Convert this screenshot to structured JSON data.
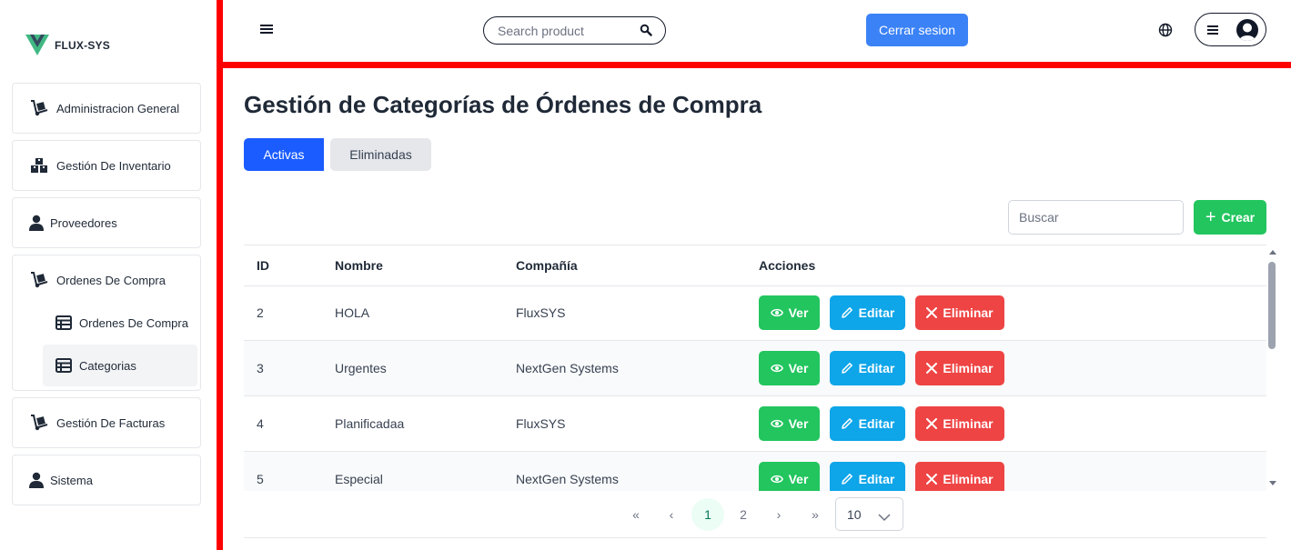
{
  "brand": {
    "name": "FLUX-SYS"
  },
  "sidebar": {
    "items": [
      {
        "label": "Administracion General"
      },
      {
        "label": "Gestión De Inventario"
      },
      {
        "label": "Proveedores"
      },
      {
        "label": "Ordenes De Compra"
      },
      {
        "label": "Gestión De Facturas"
      },
      {
        "label": "Sistema"
      }
    ],
    "subitems": [
      {
        "label": "Ordenes De Compra"
      },
      {
        "label": "Categorias"
      }
    ]
  },
  "topbar": {
    "search_placeholder": "Search product",
    "logout_label": "Cerrar sesion"
  },
  "main": {
    "title": "Gestión de Categorías de Órdenes de Compra",
    "tabs": [
      {
        "label": "Activas"
      },
      {
        "label": "Eliminadas"
      }
    ],
    "search_placeholder": "Buscar",
    "create_label": "Crear",
    "columns": [
      "ID",
      "Nombre",
      "Compañía",
      "Acciones"
    ],
    "rows": [
      {
        "id": "2",
        "name": "HOLA",
        "company": "FluxSYS"
      },
      {
        "id": "3",
        "name": "Urgentes",
        "company": "NextGen Systems"
      },
      {
        "id": "4",
        "name": "Planificadaa",
        "company": "FluxSYS"
      },
      {
        "id": "5",
        "name": "Especial",
        "company": "NextGen Systems"
      }
    ],
    "actions": {
      "view": "Ver",
      "edit": "Editar",
      "delete": "Eliminar"
    },
    "pagination": {
      "first": "«",
      "prev": "‹",
      "pages": [
        "1",
        "2"
      ],
      "next": "›",
      "last": "»",
      "per_page": "10"
    }
  },
  "colors": {
    "accent": "#1a5cff",
    "success": "#22c55e",
    "info": "#0ea5e9",
    "danger": "#ef4444",
    "frame": "#ff0000",
    "logout": "#3b82f6"
  }
}
